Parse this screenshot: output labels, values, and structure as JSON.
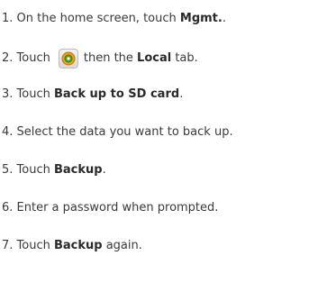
{
  "steps": [
    {
      "prefix": "1. On the home screen, touch ",
      "bold": "Mgmt.",
      "suffix": "."
    },
    {
      "prefix": "2. Touch",
      "icon": "backup-app-icon",
      "middle": "then the ",
      "bold": "Local",
      "suffix": " tab."
    },
    {
      "prefix": "3. Touch ",
      "bold": "Back up to SD card",
      "suffix": "."
    },
    {
      "text": "4. Select the data you want to back up."
    },
    {
      "prefix": "5. Touch ",
      "bold": "Backup",
      "suffix": "."
    },
    {
      "text": "6. Enter a password when prompted."
    },
    {
      "prefix": "7. Touch ",
      "bold": "Backup",
      "suffix": " again."
    }
  ]
}
